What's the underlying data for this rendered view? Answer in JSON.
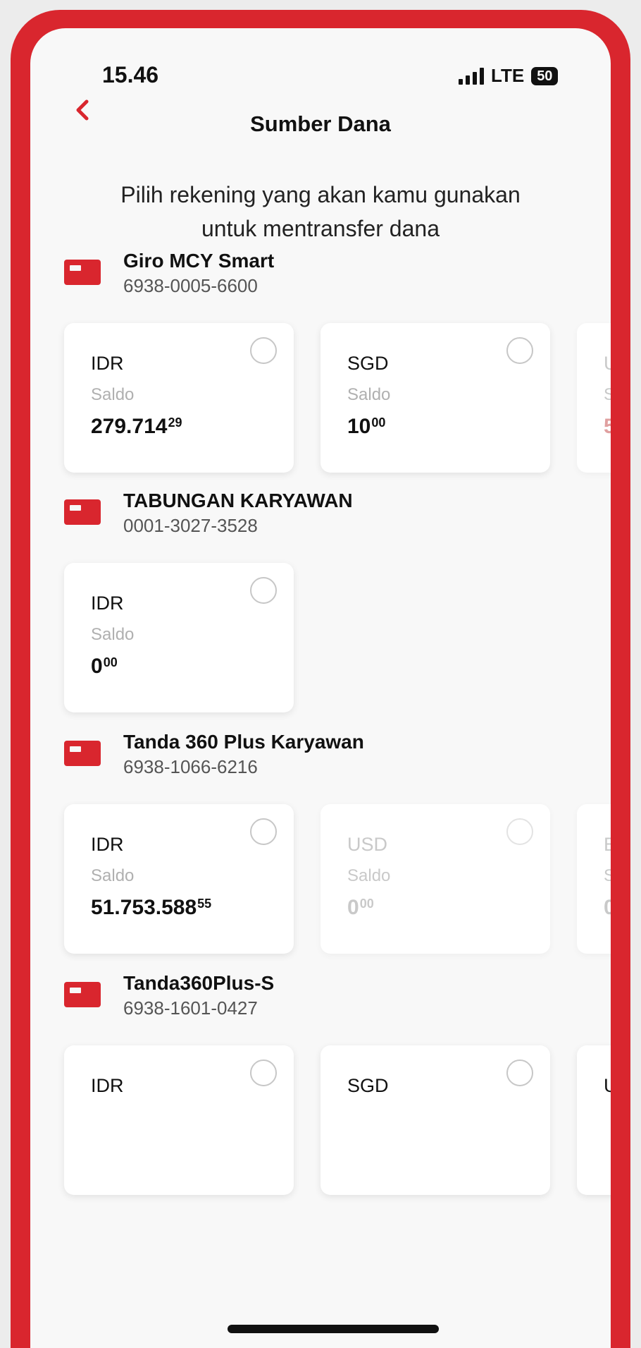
{
  "status_bar": {
    "time": "15.46",
    "network": "LTE",
    "battery": "50"
  },
  "header": {
    "title": "Sumber Dana"
  },
  "instruction": "Pilih rekening yang akan kamu gunakan untuk mentransfer dana",
  "accounts": [
    {
      "name": "Giro MCY Smart",
      "number": "6938-0005-6600",
      "balances": [
        {
          "currency": "IDR",
          "label": "Saldo",
          "amount": "279.714",
          "cents": "29"
        },
        {
          "currency": "SGD",
          "label": "Saldo",
          "amount": "10",
          "cents": "00"
        },
        {
          "currency": "USD",
          "label": "Saldo",
          "amount": "5",
          "cents": "00"
        }
      ]
    },
    {
      "name": "TABUNGAN KARYAWAN",
      "number": "0001-3027-3528",
      "balances": [
        {
          "currency": "IDR",
          "label": "Saldo",
          "amount": "0",
          "cents": "00"
        }
      ]
    },
    {
      "name": "Tanda 360 Plus Karyawan",
      "number": "6938-1066-6216",
      "balances": [
        {
          "currency": "IDR",
          "label": "Saldo",
          "amount": "51.753.588",
          "cents": "55"
        },
        {
          "currency": "USD",
          "label": "Saldo",
          "amount": "0",
          "cents": "00"
        },
        {
          "currency": "EUR",
          "label": "Saldo",
          "amount": "0",
          "cents": "00"
        }
      ]
    },
    {
      "name": "Tanda360Plus-S",
      "number": "6938-1601-0427",
      "balances": [
        {
          "currency": "IDR",
          "label": "Saldo",
          "amount": "",
          "cents": ""
        },
        {
          "currency": "SGD",
          "label": "Saldo",
          "amount": "",
          "cents": ""
        },
        {
          "currency": "USD",
          "label": "Saldo",
          "amount": "",
          "cents": ""
        }
      ]
    }
  ],
  "colors": {
    "brand": "#d9262e",
    "background": "#f8f8f8",
    "card": "#ffffff",
    "muted": "#b0b0b0"
  }
}
